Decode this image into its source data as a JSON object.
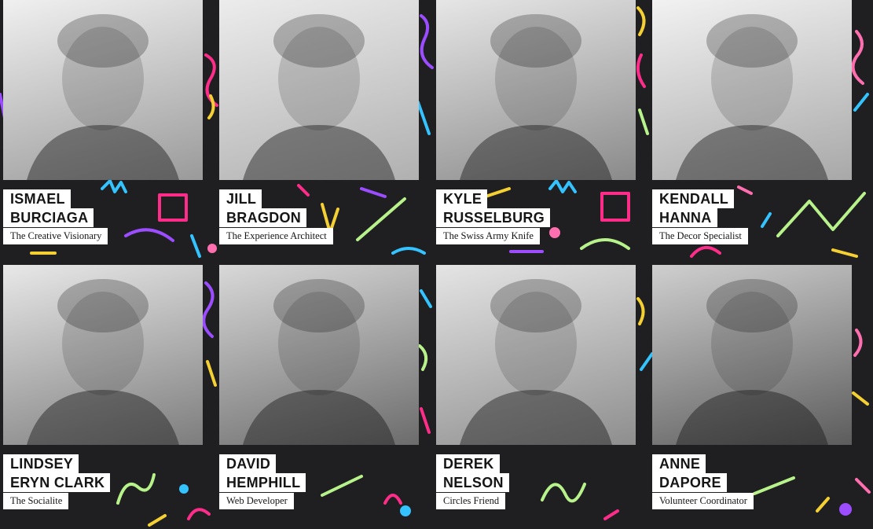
{
  "colors": {
    "background": "#1f1f22",
    "label_bg": "#ffffff",
    "label_text": "#151515",
    "squiggle_palette": [
      "#ff2d8a",
      "#f5d033",
      "#9b4dff",
      "#34c3ff",
      "#b7f28a",
      "#ffffff",
      "#ff6fb0"
    ]
  },
  "team": [
    {
      "name_line1": "ISMAEL",
      "name_line2": "BURCIAGA",
      "role": "The Creative Visionary",
      "photo_icon": "portrait-photo"
    },
    {
      "name_line1": "JILL",
      "name_line2": "BRAGDON",
      "role": "The Experience Architect",
      "photo_icon": "portrait-photo"
    },
    {
      "name_line1": "KYLE",
      "name_line2": "RUSSELBURG",
      "role": "The Swiss Army Knife",
      "photo_icon": "portrait-photo"
    },
    {
      "name_line1": "KENDALL",
      "name_line2": "HANNA",
      "role": "The Decor Specialist",
      "photo_icon": "portrait-photo"
    },
    {
      "name_line1": "LINDSEY",
      "name_line2": "ERYN CLARK",
      "role": "The Socialite",
      "photo_icon": "portrait-photo"
    },
    {
      "name_line1": "DAVID",
      "name_line2": "HEMPHILL",
      "role": "Web Developer",
      "photo_icon": "portrait-photo"
    },
    {
      "name_line1": "DEREK",
      "name_line2": "NELSON",
      "role": "Circles Friend",
      "photo_icon": "portrait-photo"
    },
    {
      "name_line1": "ANNE",
      "name_line2": "DAPORE",
      "role": "Volunteer Coordinator",
      "photo_icon": "portrait-photo"
    }
  ]
}
